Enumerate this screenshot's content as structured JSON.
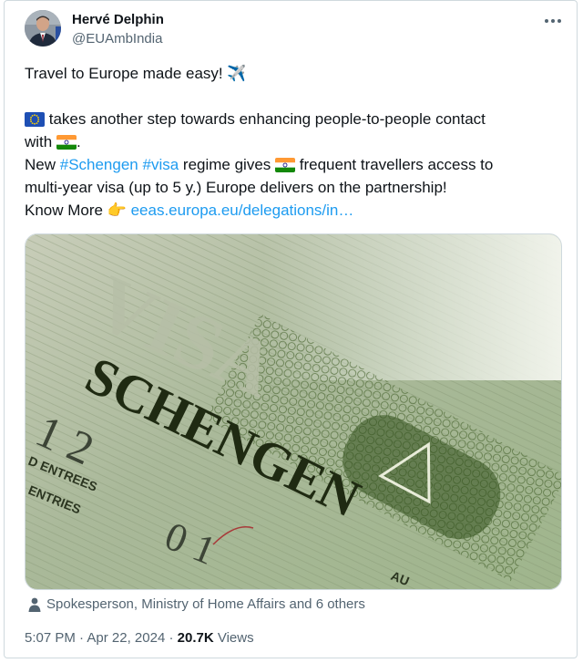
{
  "author": {
    "name": "Hervé Delphin",
    "handle": "@EUAmbIndia"
  },
  "tweet": {
    "line1": "Travel to Europe made easy! ✈️",
    "line2_text": " takes another step towards enhancing people-to-people contact",
    "line3_text": "with ",
    "line3_end": ".",
    "line4_prefix": "New ",
    "hashtag_schengen": "#Schengen",
    "hashtag_visa": "#visa",
    "line4_mid": " regime gives ",
    "line4_end": " frequent travellers access to",
    "line5": "multi-year visa (up to 5 y.) Europe delivers on the partnership!",
    "line6_prefix": "Know More 👉 ",
    "link_text": "eeas.europa.eu/delegations/in…"
  },
  "icons": {
    "eu_flag": "eu-flag-icon",
    "india_flag": "india-flag-icon",
    "more": "more-options-icon",
    "person": "person-icon"
  },
  "image_text": {
    "visa": "VISA",
    "schengen": "SCHENGEN",
    "entries_1": "D ENTREES",
    "entries_2": "ENTRIES",
    "number_1": "1 2",
    "number_2": "0 1",
    "au": "AU"
  },
  "social_context": "Spokesperson, Ministry of Home Affairs and 6 others",
  "meta": {
    "time": "5:07 PM",
    "separator": " · ",
    "date": "Apr 22, 2024",
    "views_count": "20.7K",
    "views_label": " Views"
  },
  "colors": {
    "link": "#1d9bf0",
    "secondary_text": "#536471",
    "border": "#cfd9de"
  }
}
